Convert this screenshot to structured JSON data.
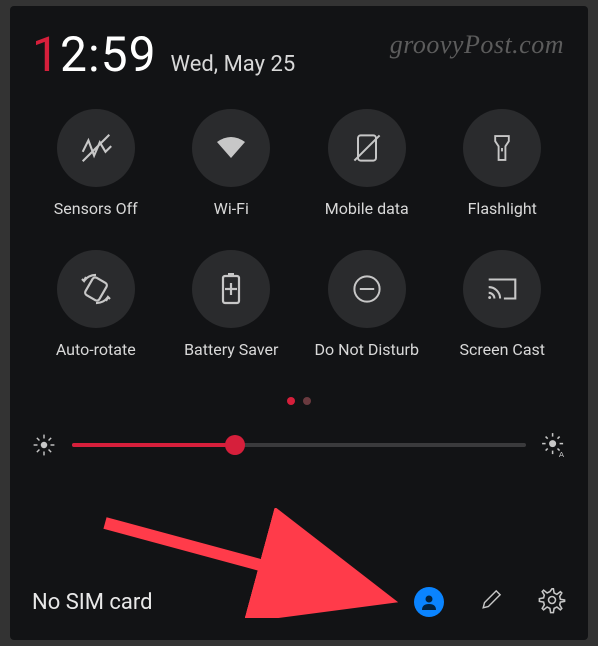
{
  "clock": {
    "leading": "1",
    "rest": "2:59"
  },
  "date": "Wed, May 25",
  "watermark": "groovyPost.com",
  "tiles": [
    {
      "label": "Sensors Off"
    },
    {
      "label": "Wi-Fi"
    },
    {
      "label": "Mobile data"
    },
    {
      "label": "Flashlight"
    },
    {
      "label": "Auto-rotate"
    },
    {
      "label": "Battery Saver"
    },
    {
      "label": "Do Not Disturb"
    },
    {
      "label": "Screen Cast"
    }
  ],
  "brightness": {
    "percent": 36
  },
  "footer": {
    "sim": "No SIM card"
  },
  "accent": "#d61f3b"
}
